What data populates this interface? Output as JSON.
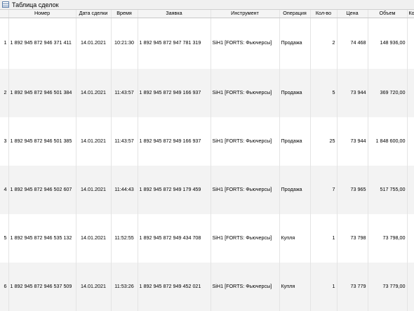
{
  "window": {
    "title": "Таблица сделок"
  },
  "table": {
    "headers": [
      "",
      "Номер",
      "Дата сделки",
      "Время",
      "Заявка",
      "Инструмент",
      "Операция",
      "Кол-во",
      "Цена",
      "Объем",
      "Ко"
    ],
    "rows": [
      [
        "1",
        "1 892 945 872 946 371 411",
        "14.01.2021",
        "10:21:30",
        "1 892 945 872 947 781 319",
        "SiH1 [FORTS: Фьючерсы]",
        "Продажа",
        "2",
        "74 468",
        "148 936,00",
        ""
      ],
      [
        "2",
        "1 892 945 872 946 501 384",
        "14.01.2021",
        "11:43:57",
        "1 892 945 872 949 166 937",
        "SiH1 [FORTS: Фьючерсы]",
        "Продажа",
        "5",
        "73 944",
        "369 720,00",
        ""
      ],
      [
        "3",
        "1 892 945 872 946 501 385",
        "14.01.2021",
        "11:43:57",
        "1 892 945 872 949 166 937",
        "SiH1 [FORTS: Фьючерсы]",
        "Продажа",
        "25",
        "73 944",
        "1 848 600,00",
        ""
      ],
      [
        "4",
        "1 892 945 872 946 502 607",
        "14.01.2021",
        "11:44:43",
        "1 892 945 872 949 179 459",
        "SiH1 [FORTS: Фьючерсы]",
        "Продажа",
        "7",
        "73 965",
        "517 755,00",
        ""
      ],
      [
        "5",
        "1 892 945 872 946 535 132",
        "14.01.2021",
        "11:52:55",
        "1 892 945 872 949 434 708",
        "SiH1 [FORTS: Фьючерсы]",
        "Купля",
        "1",
        "73 798",
        "73 798,00",
        ""
      ],
      [
        "6",
        "1 892 945 872 946 537 509",
        "14.01.2021",
        "11:53:26",
        "1 892 945 872 949 452 021",
        "SiH1 [FORTS: Фьючерсы]",
        "Купля",
        "1",
        "73 779",
        "73 779,00",
        ""
      ]
    ]
  }
}
